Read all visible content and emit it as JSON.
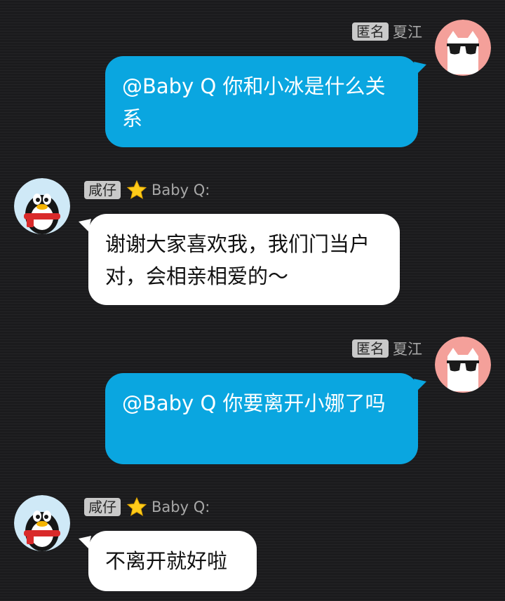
{
  "messages": [
    {
      "type": "outgoing",
      "badge": "匿名",
      "name": "夏江",
      "avatar": "cat-sunglasses-avatar",
      "text": "@Baby Q 你和小冰是什么关系"
    },
    {
      "type": "incoming",
      "badge": "咸仔",
      "name": "Baby Q:",
      "avatar": "penguin-avatar",
      "icon": "star-icon",
      "text": "谢谢大家喜欢我，我们门当户对，会相亲相爱的～"
    },
    {
      "type": "outgoing",
      "badge": "匿名",
      "name": "夏江",
      "avatar": "cat-sunglasses-avatar",
      "text": "@Baby Q 你要离开小娜了吗"
    },
    {
      "type": "incoming",
      "badge": "咸仔",
      "name": "Baby Q:",
      "avatar": "penguin-avatar",
      "icon": "star-icon",
      "text": "不离开就好啦"
    }
  ],
  "colors": {
    "background": "#1b1b1d",
    "outgoing_bubble": "#0aa6e0",
    "incoming_bubble": "#ffffff",
    "badge": "#c9c9c9",
    "avatar_cat_bg": "#f4a09a"
  }
}
